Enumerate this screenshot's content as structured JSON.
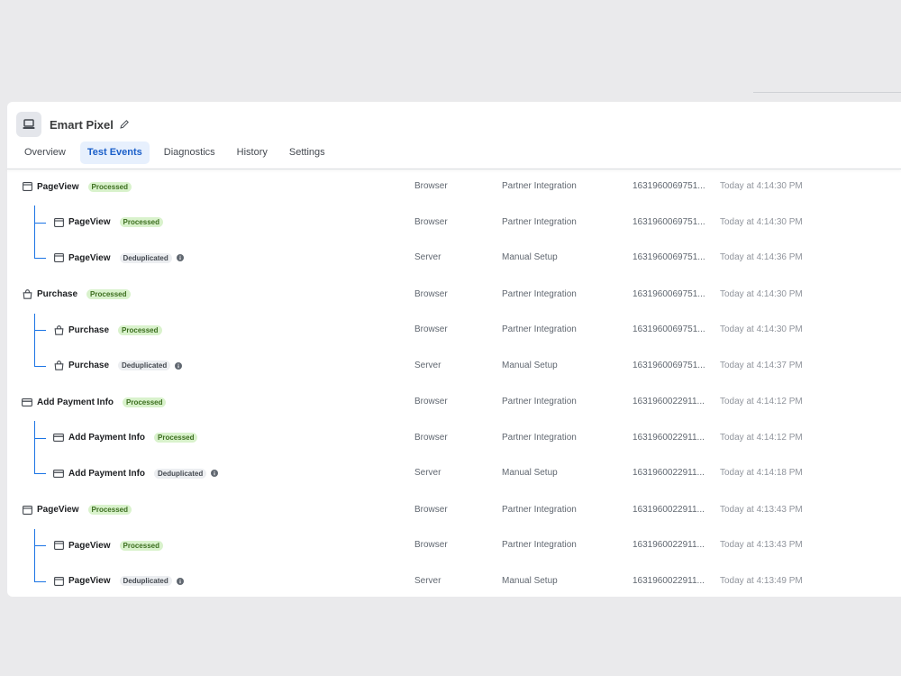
{
  "header": {
    "pixel_icon": "laptop-icon",
    "title": "Emart Pixel",
    "edit_icon": "pencil-icon"
  },
  "tabs": [
    {
      "label": "Overview",
      "active": false
    },
    {
      "label": "Test Events",
      "active": true
    },
    {
      "label": "Diagnostics",
      "active": false
    },
    {
      "label": "History",
      "active": false
    },
    {
      "label": "Settings",
      "active": false
    }
  ],
  "colors": {
    "accent": "#1b74e4",
    "processed_bg": "#d9f2cc",
    "processed_text": "#3c6e1f",
    "dedup_bg": "#eceef1"
  },
  "event_groups": [
    {
      "icon": "browser-window-icon",
      "name": "PageView",
      "status": "Processed",
      "source": "Browser",
      "method": "Partner Integration",
      "id": "1631960069751...",
      "time": "Today at 4:14:30 PM",
      "children": [
        {
          "icon": "browser-window-icon",
          "name": "PageView",
          "status": "Processed",
          "source": "Browser",
          "method": "Partner Integration",
          "id": "1631960069751...",
          "time": "Today at 4:14:30 PM"
        },
        {
          "icon": "browser-window-icon",
          "name": "PageView",
          "status": "Deduplicated",
          "source": "Server",
          "method": "Manual Setup",
          "id": "1631960069751...",
          "time": "Today at 4:14:36 PM"
        }
      ]
    },
    {
      "icon": "shopping-bag-icon",
      "name": "Purchase",
      "status": "Processed",
      "source": "Browser",
      "method": "Partner Integration",
      "id": "1631960069751...",
      "time": "Today at 4:14:30 PM",
      "children": [
        {
          "icon": "shopping-bag-icon",
          "name": "Purchase",
          "status": "Processed",
          "source": "Browser",
          "method": "Partner Integration",
          "id": "1631960069751...",
          "time": "Today at 4:14:30 PM"
        },
        {
          "icon": "shopping-bag-icon",
          "name": "Purchase",
          "status": "Deduplicated",
          "source": "Server",
          "method": "Manual Setup",
          "id": "1631960069751...",
          "time": "Today at 4:14:37 PM"
        }
      ]
    },
    {
      "icon": "credit-card-icon",
      "name": "Add Payment Info",
      "status": "Processed",
      "source": "Browser",
      "method": "Partner Integration",
      "id": "1631960022911...",
      "time": "Today at 4:14:12 PM",
      "children": [
        {
          "icon": "credit-card-icon",
          "name": "Add Payment Info",
          "status": "Processed",
          "source": "Browser",
          "method": "Partner Integration",
          "id": "1631960022911...",
          "time": "Today at 4:14:12 PM"
        },
        {
          "icon": "credit-card-icon",
          "name": "Add Payment Info",
          "status": "Deduplicated",
          "source": "Server",
          "method": "Manual Setup",
          "id": "1631960022911...",
          "time": "Today at 4:14:18 PM"
        }
      ]
    },
    {
      "icon": "browser-window-icon",
      "name": "PageView",
      "status": "Processed",
      "source": "Browser",
      "method": "Partner Integration",
      "id": "1631960022911...",
      "time": "Today at 4:13:43 PM",
      "children": [
        {
          "icon": "browser-window-icon",
          "name": "PageView",
          "status": "Processed",
          "source": "Browser",
          "method": "Partner Integration",
          "id": "1631960022911...",
          "time": "Today at 4:13:43 PM"
        },
        {
          "icon": "browser-window-icon",
          "name": "PageView",
          "status": "Deduplicated",
          "source": "Server",
          "method": "Manual Setup",
          "id": "1631960022911...",
          "time": "Today at 4:13:49 PM"
        }
      ]
    }
  ]
}
